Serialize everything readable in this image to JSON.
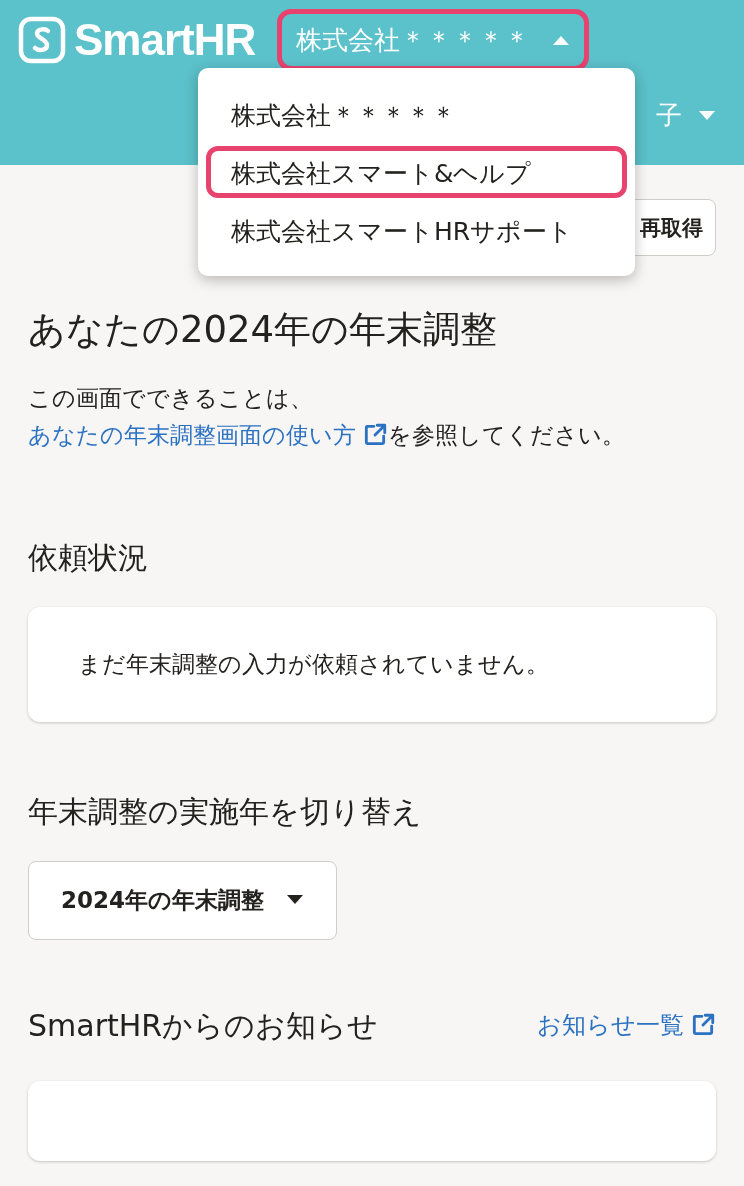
{
  "header": {
    "logo": "SmartHR",
    "company_switcher": {
      "label": "株式会社＊＊＊＊＊",
      "expanded": true,
      "highlighted": true
    },
    "user_name": "子"
  },
  "company_menu": [
    {
      "label": "株式会社＊＊＊＊＊",
      "highlighted": false
    },
    {
      "label": "株式会社スマート&ヘルプ",
      "highlighted": true
    },
    {
      "label": "株式会社スマートHRサポート",
      "highlighted": false
    }
  ],
  "refresh_button": "再取得",
  "title": "あなたの2024年の年末調整",
  "intro": {
    "text": "この画面でできることは、",
    "link": "あなたの年末調整画面の使い方",
    "after": "を参照してください。"
  },
  "request_status": {
    "heading": "依頼状況",
    "message": "まだ年末調整の入力が依頼されていません。"
  },
  "year_switch": {
    "heading": "年末調整の実施年を切り替え",
    "selected": "2024年の年末調整"
  },
  "notices": {
    "heading": "SmartHRからのお知らせ",
    "link": "お知らせ一覧"
  }
}
